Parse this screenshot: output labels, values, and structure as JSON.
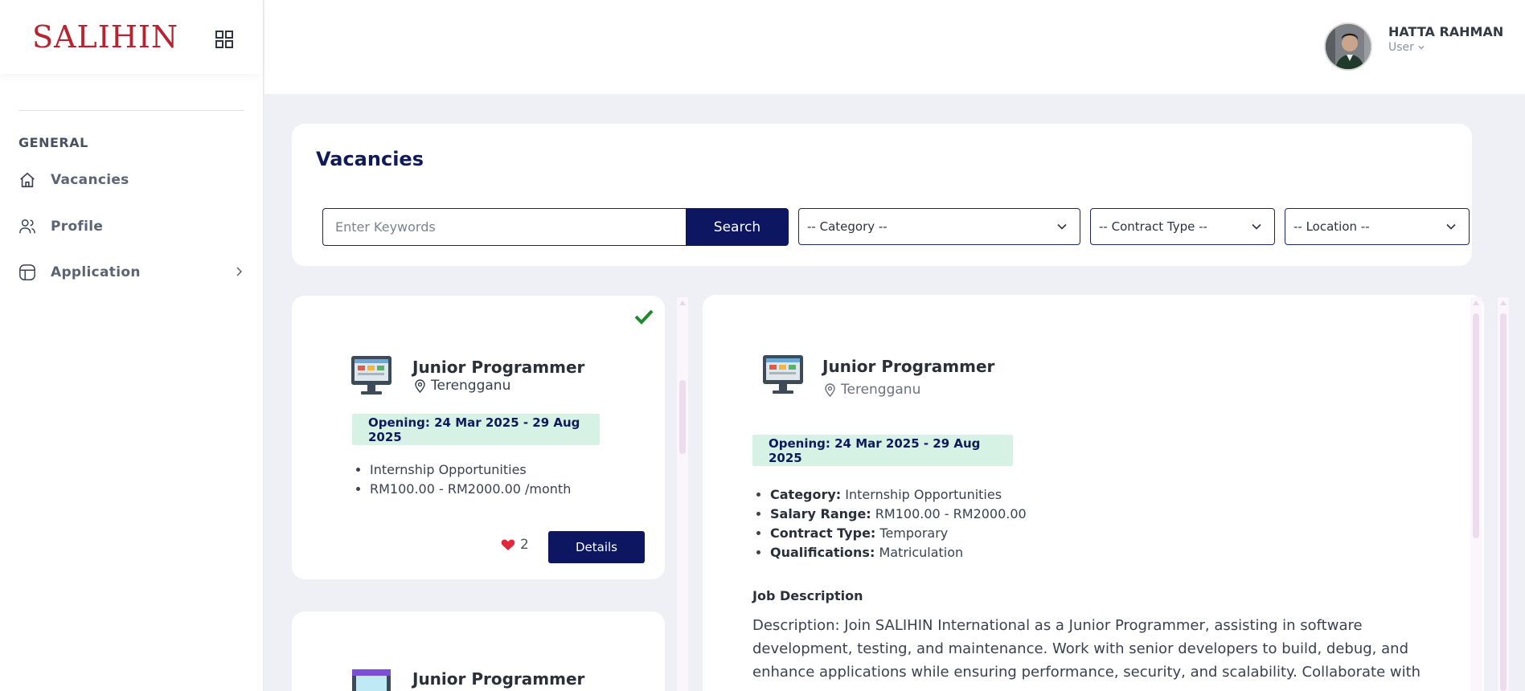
{
  "brand": {
    "logo_text": "SALIHIN"
  },
  "sidebar": {
    "heading": "GENERAL",
    "items": [
      {
        "label": "Vacancies",
        "icon": "home-icon"
      },
      {
        "label": "Profile",
        "icon": "users-icon"
      },
      {
        "label": "Application",
        "icon": "application-icon",
        "has_submenu": true
      }
    ]
  },
  "header": {
    "user_name": "HATTA RAHMAN",
    "user_role": "User"
  },
  "vacancies": {
    "title": "Vacancies",
    "search_placeholder": "Enter Keywords",
    "search_button": "Search",
    "filters": {
      "category": "-- Category --",
      "contract_type": "-- Contract Type --",
      "location": "-- Location --"
    }
  },
  "job_list": [
    {
      "title": "Junior Programmer",
      "location": "Terengganu",
      "opening": "Opening: 24 Mar 2025 - 29 Aug 2025",
      "category": "Internship Opportunities",
      "salary": "RM100.00 - RM2000.00 /month",
      "likes": "2",
      "details_button": "Details",
      "applied": true
    },
    {
      "title": "Junior Programmer"
    }
  ],
  "detail": {
    "title": "Junior Programmer",
    "location": "Terengganu",
    "opening": "Opening: 24 Mar 2025 - 29 Aug 2025",
    "fields": [
      {
        "label": "Category:",
        "value": "Internship Opportunities"
      },
      {
        "label": "Salary Range:",
        "value": "RM100.00 - RM2000.00"
      },
      {
        "label": "Contract Type:",
        "value": "Temporary"
      },
      {
        "label": "Qualifications:",
        "value": "Matriculation"
      }
    ],
    "job_description_heading": "Job Description",
    "job_description": "Description: Join SALIHIN International as a Junior Programmer, assisting in software development, testing, and maintenance. Work with senior developers to build, debug, and enhance applications while ensuring performance, security, and scalability. Collaborate with"
  },
  "colors": {
    "brand_red": "#b8232f",
    "primary_navy": "#0d1761",
    "badge_green": "#d6f2e5",
    "heart_red": "#e0283a",
    "check_green": "#1e8a2c"
  }
}
